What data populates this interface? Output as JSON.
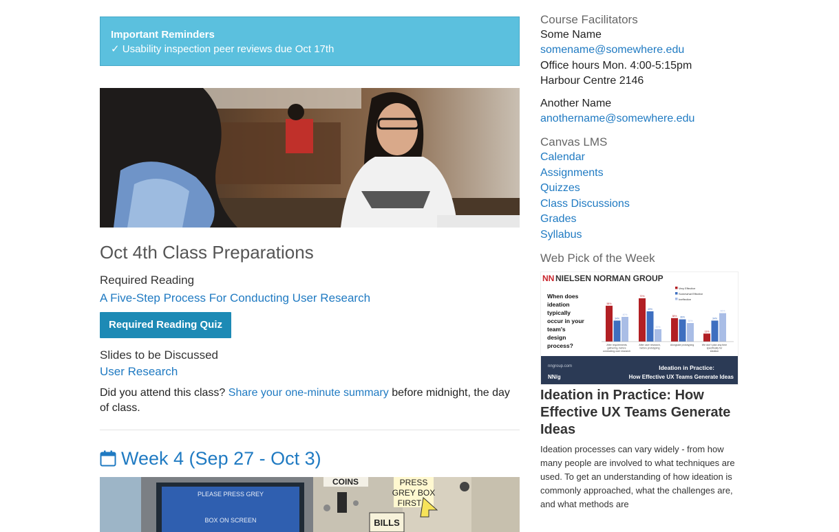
{
  "reminders": {
    "title": "Important Reminders",
    "items": [
      "✓ Usability inspection peer reviews due Oct 17th"
    ]
  },
  "oct4": {
    "title": "Oct 4th Class Preparations",
    "reading_label": "Required Reading",
    "reading_link": "A Five-Step Process For Conducting User Research",
    "quiz_button": "Required Reading Quiz",
    "slides_label": "Slides to be Discussed",
    "slides_link": "User Research",
    "attend_prefix": "Did you attend this class? ",
    "attend_link": "Share your one-minute summary",
    "attend_suffix": " before midnight, the day of class."
  },
  "week4": {
    "title": "Week 4 (Sep 27 - Oct 3)"
  },
  "photo2_signs": {
    "screen": "PLEASE PRESS GREY",
    "screen2": "BOX ON SCREEN",
    "coins": "COINS",
    "press": "PRESS",
    "grey_box": "GREY BOX",
    "first": "FIRST",
    "bills": "BILLS"
  },
  "facilitators": {
    "heading": "Course Facilitators",
    "people": [
      {
        "name": "Some Name",
        "email": "somename@somewhere.edu",
        "hours": "Office hours Mon. 4:00-5:15pm",
        "room": "Harbour Centre 2146"
      },
      {
        "name": "Another Name",
        "email": "anothername@somewhere.edu"
      }
    ]
  },
  "canvas": {
    "heading": "Canvas LMS",
    "links": [
      "Calendar",
      "Assignments",
      "Quizzes",
      "Class Discussions",
      "Grades",
      "Syllabus"
    ]
  },
  "webpick": {
    "heading": "Web Pick of the Week",
    "brand": "NIELSEN NORMAN GROUP",
    "brand_mark": "NN",
    "chart_question": "When does ideation typically occur in your team's design process?",
    "chart_legend": [
      "Very Effective",
      "Somewhat Effective",
      "Ineffective"
    ],
    "chart_categories": [
      "After requirements gathering, before conducting user research",
      "After user research, before prototyping",
      "Alongside prototyping",
      "We don't plan any time specifically for ideation"
    ],
    "chart_data": {
      "type": "bar",
      "categories": [
        "After requirements gathering, before conducting user research",
        "After user research, before prototyping",
        "Alongside prototyping",
        "We don't plan any time specifically for ideation"
      ],
      "series": [
        {
          "name": "Very Effective",
          "values": [
            58,
            70,
            38,
            13
          ]
        },
        {
          "name": "Somewhat Effective",
          "values": [
            34,
            49,
            36,
            34
          ]
        },
        {
          "name": "Ineffective",
          "values": [
            40,
            20,
            30,
            46
          ]
        }
      ],
      "ylim": [
        0,
        80
      ]
    },
    "banner_site": "nngroup.com",
    "banner_logo": "NN/g",
    "banner_title": "Ideation in Practice:",
    "banner_subtitle": "How Effective UX Teams Generate Ideas",
    "article_title": "Ideation in Practice: How Effective UX Teams Generate Ideas",
    "article_body": "Ideation processes can vary widely - from how many people are involved to what techniques are used. To get an understanding of how ideation is commonly approached, what the challenges are, and what methods are"
  },
  "colors": {
    "accent": "#1f7ac2",
    "reminder_bg": "#5bc0de",
    "button": "#1d8ab5",
    "series": [
      "#b21f24",
      "#3e6fc0",
      "#a9bde6"
    ]
  }
}
